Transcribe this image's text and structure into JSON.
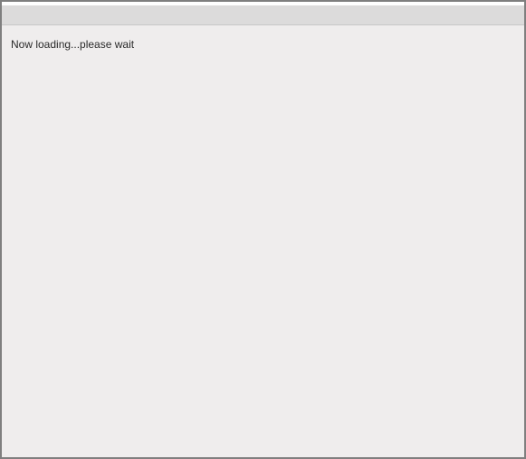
{
  "loading": {
    "message": "Now loading...please wait"
  }
}
